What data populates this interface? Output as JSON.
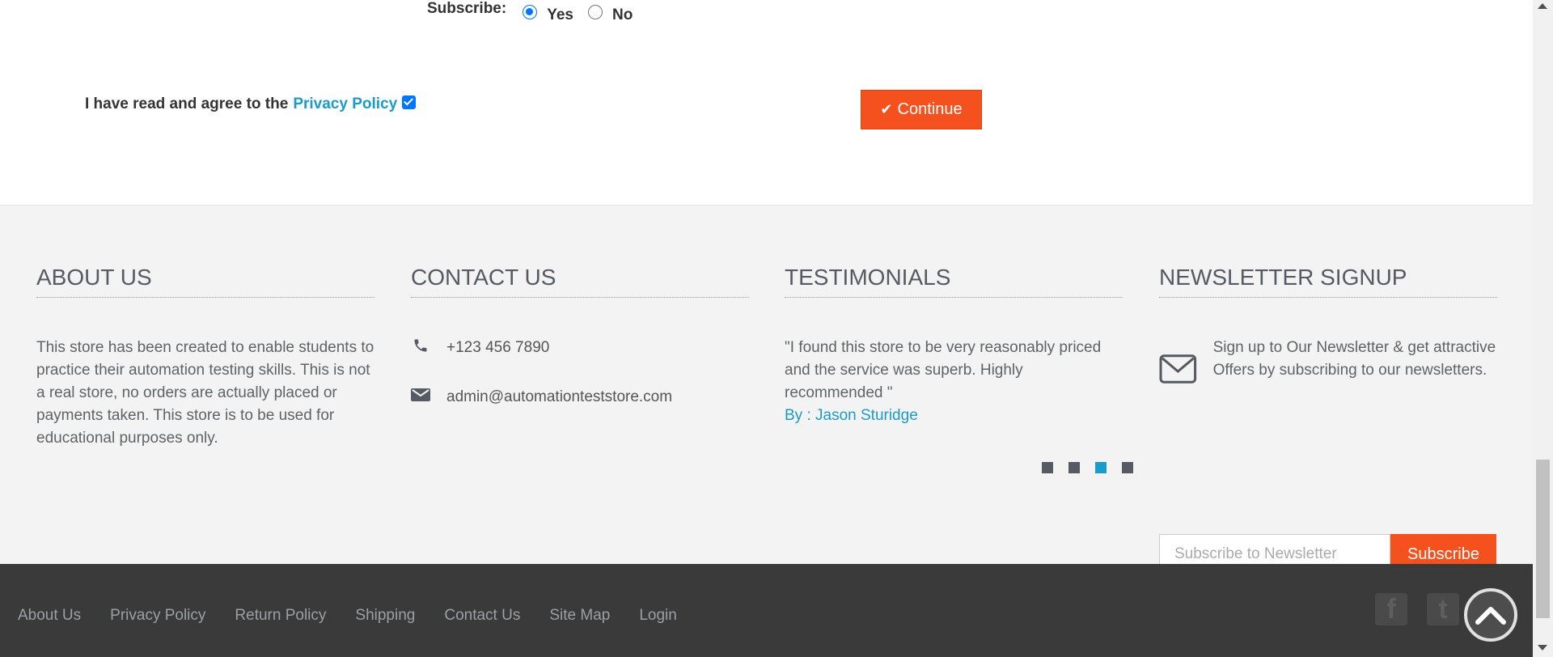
{
  "form": {
    "subscribe_label": "Subscribe:",
    "yes_label": "Yes",
    "no_label": "No",
    "agree_text": "I have read and agree to the",
    "privacy_link": "Privacy Policy",
    "continue_label": "Continue",
    "subscribe_selected": "Yes",
    "agree_checked": true
  },
  "footer": {
    "about": {
      "title": "ABOUT US",
      "text": "This store has been created to enable students to practice their automation testing skills. This is not a real store, no orders are actually placed or payments taken. This store is to be used for educational purposes only."
    },
    "contact": {
      "title": "CONTACT US",
      "phone": "+123 456 7890",
      "email": "admin@automationteststore.com"
    },
    "testimonials": {
      "title": "TESTIMONIALS",
      "quote": "\"I found this store to be very reasonably priced and the service was superb. Highly recommended \"",
      "author": "By : Jason Sturidge",
      "active_dot": 3,
      "dot_count": 4
    },
    "newsletter": {
      "title": "NEWSLETTER SIGNUP",
      "text": "Sign up to Our Newsletter & get attractive Offers by subscribing to our newsletters.",
      "placeholder": "Subscribe to Newsletter",
      "button": "Subscribe"
    },
    "links": [
      "About Us",
      "Privacy Policy",
      "Return Policy",
      "Shipping",
      "Contact Us",
      "Site Map",
      "Login"
    ],
    "social": {
      "facebook": "f",
      "twitter": "t"
    }
  },
  "colors": {
    "accent": "#f4511e",
    "link": "#1a9bc9",
    "footer_bg": "#f3f3f3",
    "footer_bottom_bg": "#3a3a3a"
  }
}
